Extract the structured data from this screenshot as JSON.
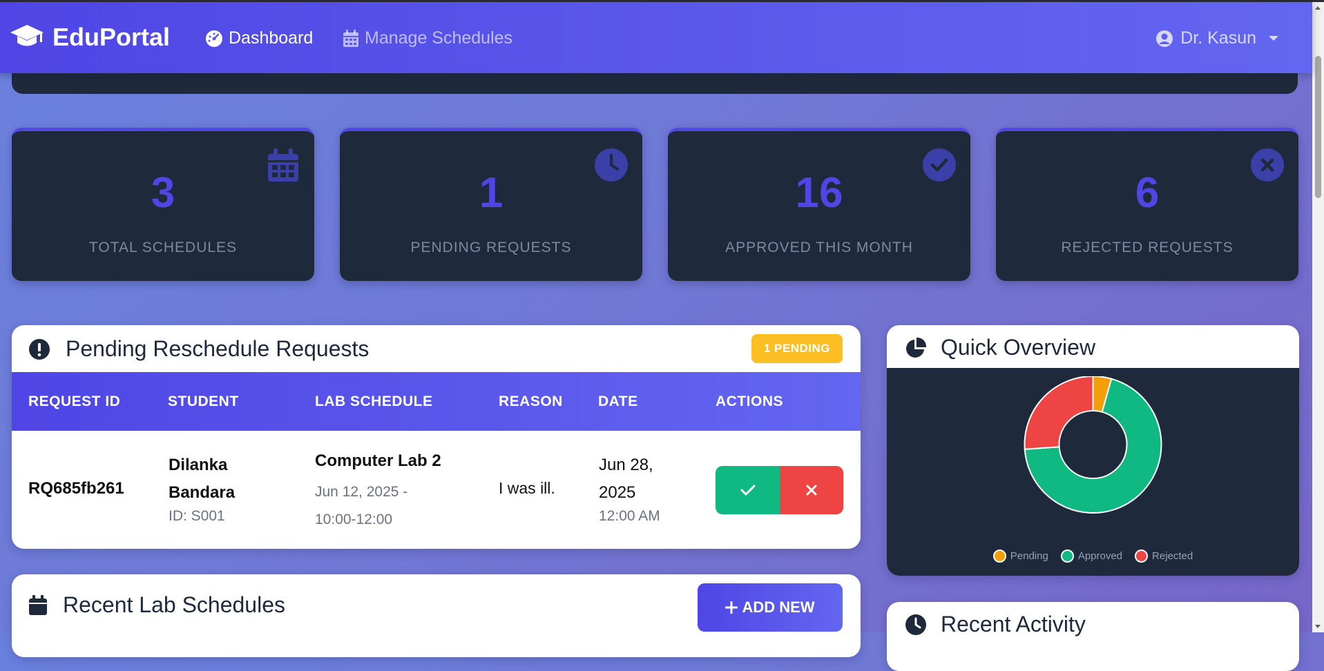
{
  "navbar": {
    "brand": "EduPortal",
    "dashboard": "Dashboard",
    "manage_schedules": "Manage Schedules",
    "user": "Dr. Kasun",
    "brand_icon": "graduation-cap-icon",
    "dashboard_icon": "tachometer-icon",
    "schedules_icon": "calendar-icon",
    "user_icon": "user-circle-icon"
  },
  "stats": [
    {
      "value": "3",
      "label": "TOTAL SCHEDULES",
      "icon": "calendar-icon"
    },
    {
      "value": "1",
      "label": "PENDING REQUESTS",
      "icon": "clock-icon"
    },
    {
      "value": "16",
      "label": "APPROVED THIS MONTH",
      "icon": "check-circle-icon"
    },
    {
      "value": "6",
      "label": "REJECTED REQUESTS",
      "icon": "times-circle-icon"
    }
  ],
  "pending": {
    "title": "Pending Reschedule Requests",
    "badge": "1 PENDING",
    "columns": [
      "REQUEST ID",
      "STUDENT",
      "LAB SCHEDULE",
      "REASON",
      "DATE",
      "ACTIONS"
    ],
    "rows": [
      {
        "request_id": "RQ685fb261",
        "student_name_1": "Dilanka",
        "student_name_2": "Bandara",
        "student_id": "ID: S001",
        "lab": "Computer Lab 2",
        "lab_date": "Jun 12, 2025 -",
        "lab_time": "10:00-12:00",
        "reason": "I was ill.",
        "date_1": "Jun 28,",
        "date_2": "2025",
        "time": "12:00 AM"
      }
    ]
  },
  "quick_overview": {
    "title": "Quick Overview",
    "legend": [
      "Pending",
      "Approved",
      "Rejected"
    ],
    "colors": [
      "#f59e0b",
      "#10b981",
      "#ef4444"
    ]
  },
  "chart_data": {
    "type": "pie",
    "variant": "doughnut",
    "categories": [
      "Pending",
      "Approved",
      "Rejected"
    ],
    "values": [
      1,
      16,
      6
    ],
    "legend_position": "bottom"
  },
  "recent_schedules": {
    "title": "Recent Lab Schedules",
    "add_new": "ADD NEW"
  },
  "recent_activity": {
    "title": "Recent Activity"
  }
}
